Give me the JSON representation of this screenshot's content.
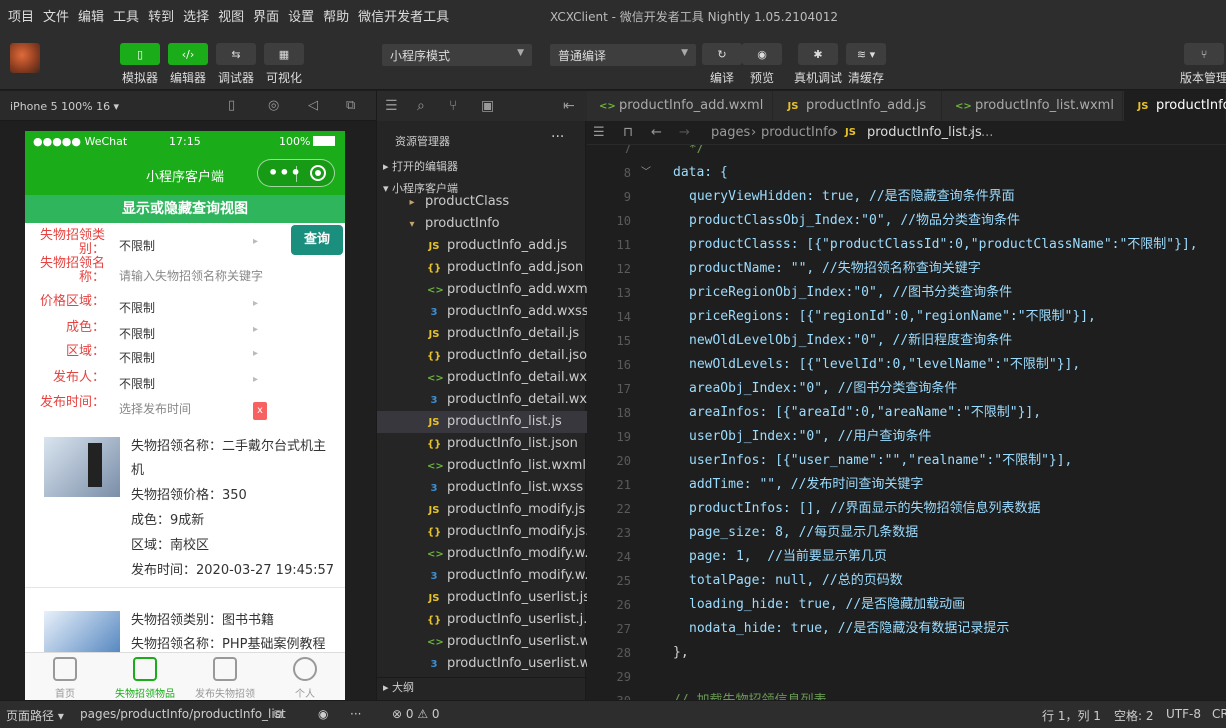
{
  "menubar": {
    "items": [
      "项目",
      "文件",
      "编辑",
      "工具",
      "转到",
      "选择",
      "视图",
      "界面",
      "设置",
      "帮助",
      "微信开发者工具"
    ],
    "window_title": "XCXClient - 微信开发者工具 Nightly 1.05.2104012"
  },
  "toolbar": {
    "simulator": "模拟器",
    "editor": "编辑器",
    "debugger": "调试器",
    "visual": "可视化",
    "mode_select": "小程序模式",
    "compile_select": "普通编译",
    "compile": "编译",
    "preview": "预览",
    "real_debug": "真机调试",
    "clear_cache": "清缓存",
    "version": "版本管理"
  },
  "simulator": {
    "device": "iPhone 5 100% 16 ▾",
    "status_left": "●●●●● WeChat",
    "status_time": "17:15",
    "status_battery": "100%",
    "nav_title": "小程序客户端",
    "toggle_label": "显示或隐藏查询视图",
    "query_button": "查询",
    "clear_button": "x",
    "filters": [
      {
        "label": "失物招领类别：",
        "value": "不限制"
      },
      {
        "label": "失物招领名称：",
        "value": "请输入失物招领名称关键字"
      },
      {
        "label": "价格区域：",
        "value": "不限制"
      },
      {
        "label": "成色：",
        "value": "不限制"
      },
      {
        "label": "区域：",
        "value": "不限制"
      },
      {
        "label": "发布人：",
        "value": "不限制"
      },
      {
        "label": "发布时间：",
        "value": "选择发布时间"
      }
    ],
    "items": [
      {
        "name_line1": "失物招领名称：二手戴尔台式机主",
        "name_line2": "机",
        "price": "失物招领价格：350",
        "condition": "成色：9成新",
        "area": "区域：南校区",
        "time": "发布时间：2020-03-27 19:45:57"
      },
      {
        "category": "失物招领类别：图书书籍",
        "name": "失物招领名称：PHP基础案例教程"
      }
    ],
    "tabs": [
      "首页",
      "失物招领物品",
      "发布失物招领",
      "个人"
    ]
  },
  "explorer": {
    "title": "资源管理器",
    "more": "···",
    "open_editors": "打开的编辑器",
    "project": "小程序客户端",
    "outline": "大纲",
    "tree": [
      {
        "name": "productClass",
        "type": "fold"
      },
      {
        "name": "productInfo",
        "type": "fold"
      },
      {
        "name": "productInfo_add.js",
        "type": "js"
      },
      {
        "name": "productInfo_add.json",
        "type": "json"
      },
      {
        "name": "productInfo_add.wxml",
        "type": "wxml"
      },
      {
        "name": "productInfo_add.wxss",
        "type": "wxss"
      },
      {
        "name": "productInfo_detail.js",
        "type": "js"
      },
      {
        "name": "productInfo_detail.json",
        "type": "json"
      },
      {
        "name": "productInfo_detail.wx...",
        "type": "wxml"
      },
      {
        "name": "productInfo_detail.wxss",
        "type": "wxss"
      },
      {
        "name": "productInfo_list.js",
        "type": "js"
      },
      {
        "name": "productInfo_list.json",
        "type": "json"
      },
      {
        "name": "productInfo_list.wxml",
        "type": "wxml"
      },
      {
        "name": "productInfo_list.wxss",
        "type": "wxss"
      },
      {
        "name": "productInfo_modify.js",
        "type": "js"
      },
      {
        "name": "productInfo_modify.js...",
        "type": "json"
      },
      {
        "name": "productInfo_modify.w...",
        "type": "wxml"
      },
      {
        "name": "productInfo_modify.w...",
        "type": "wxss"
      },
      {
        "name": "productInfo_userlist.js",
        "type": "js"
      },
      {
        "name": "productInfo_userlist.j...",
        "type": "json"
      },
      {
        "name": "productInfo_userlist.w...",
        "type": "wxml"
      },
      {
        "name": "productInfo_userlist.w...",
        "type": "wxss"
      }
    ]
  },
  "editor": {
    "tabs": [
      "productInfo_add.wxml",
      "productInfo_add.js",
      "productInfo_list.wxml",
      "productInfo_"
    ],
    "crumbs": {
      "a": "pages",
      "b": "productInfo",
      "c": "productInfo_list.js",
      "d": "..."
    },
    "lines": [
      {
        "n": "7",
        "t": " */"
      },
      {
        "n": "8",
        "t": "data: {"
      },
      {
        "n": "9",
        "t": "queryViewHidden: true, //是否隐藏查询条件界面"
      },
      {
        "n": "10",
        "t": "productClassObj_Index:\"0\", //物品分类查询条件"
      },
      {
        "n": "11",
        "t": "productClasss: [{\"productClassId\":0,\"productClassName\":\"不限制\"}],"
      },
      {
        "n": "12",
        "t": "productName: \"\", //失物招领名称查询关键字"
      },
      {
        "n": "13",
        "t": "priceRegionObj_Index:\"0\", //图书分类查询条件"
      },
      {
        "n": "14",
        "t": "priceRegions: [{\"regionId\":0,\"regionName\":\"不限制\"}],"
      },
      {
        "n": "15",
        "t": "newOldLevelObj_Index:\"0\", //新旧程度查询条件"
      },
      {
        "n": "16",
        "t": "newOldLevels: [{\"levelId\":0,\"levelName\":\"不限制\"}],"
      },
      {
        "n": "17",
        "t": "areaObj_Index:\"0\", //图书分类查询条件"
      },
      {
        "n": "18",
        "t": "areaInfos: [{\"areaId\":0,\"areaName\":\"不限制\"}],"
      },
      {
        "n": "19",
        "t": "userObj_Index:\"0\", //用户查询条件"
      },
      {
        "n": "20",
        "t": "userInfos: [{\"user_name\":\"\",\"realname\":\"不限制\"}],"
      },
      {
        "n": "21",
        "t": "addTime: \"\", //发布时间查询关键字"
      },
      {
        "n": "22",
        "t": "productInfos: [], //界面显示的失物招领信息列表数据"
      },
      {
        "n": "23",
        "t": "page_size: 8, //每页显示几条数据"
      },
      {
        "n": "24",
        "t": "page: 1,  //当前要显示第几页"
      },
      {
        "n": "25",
        "t": "totalPage: null, //总的页码数"
      },
      {
        "n": "26",
        "t": "loading_hide: true, //是否隐藏加载动画"
      },
      {
        "n": "27",
        "t": "nodata_hide: true, //是否隐藏没有数据记录提示"
      },
      {
        "n": "28",
        "t": "},"
      },
      {
        "n": "29",
        "t": ""
      },
      {
        "n": "30",
        "t": "// 加载失物招领信息列表"
      }
    ]
  },
  "bottombar": {
    "page_path_label": "页面路径 ▾",
    "page_path": "pages/productInfo/productInfo_list",
    "problems": "⊗ 0 ⚠ 0",
    "cursor": "行 1，列 1",
    "spaces": "空格: 2",
    "encoding": "UTF-8",
    "eol": "CR"
  }
}
